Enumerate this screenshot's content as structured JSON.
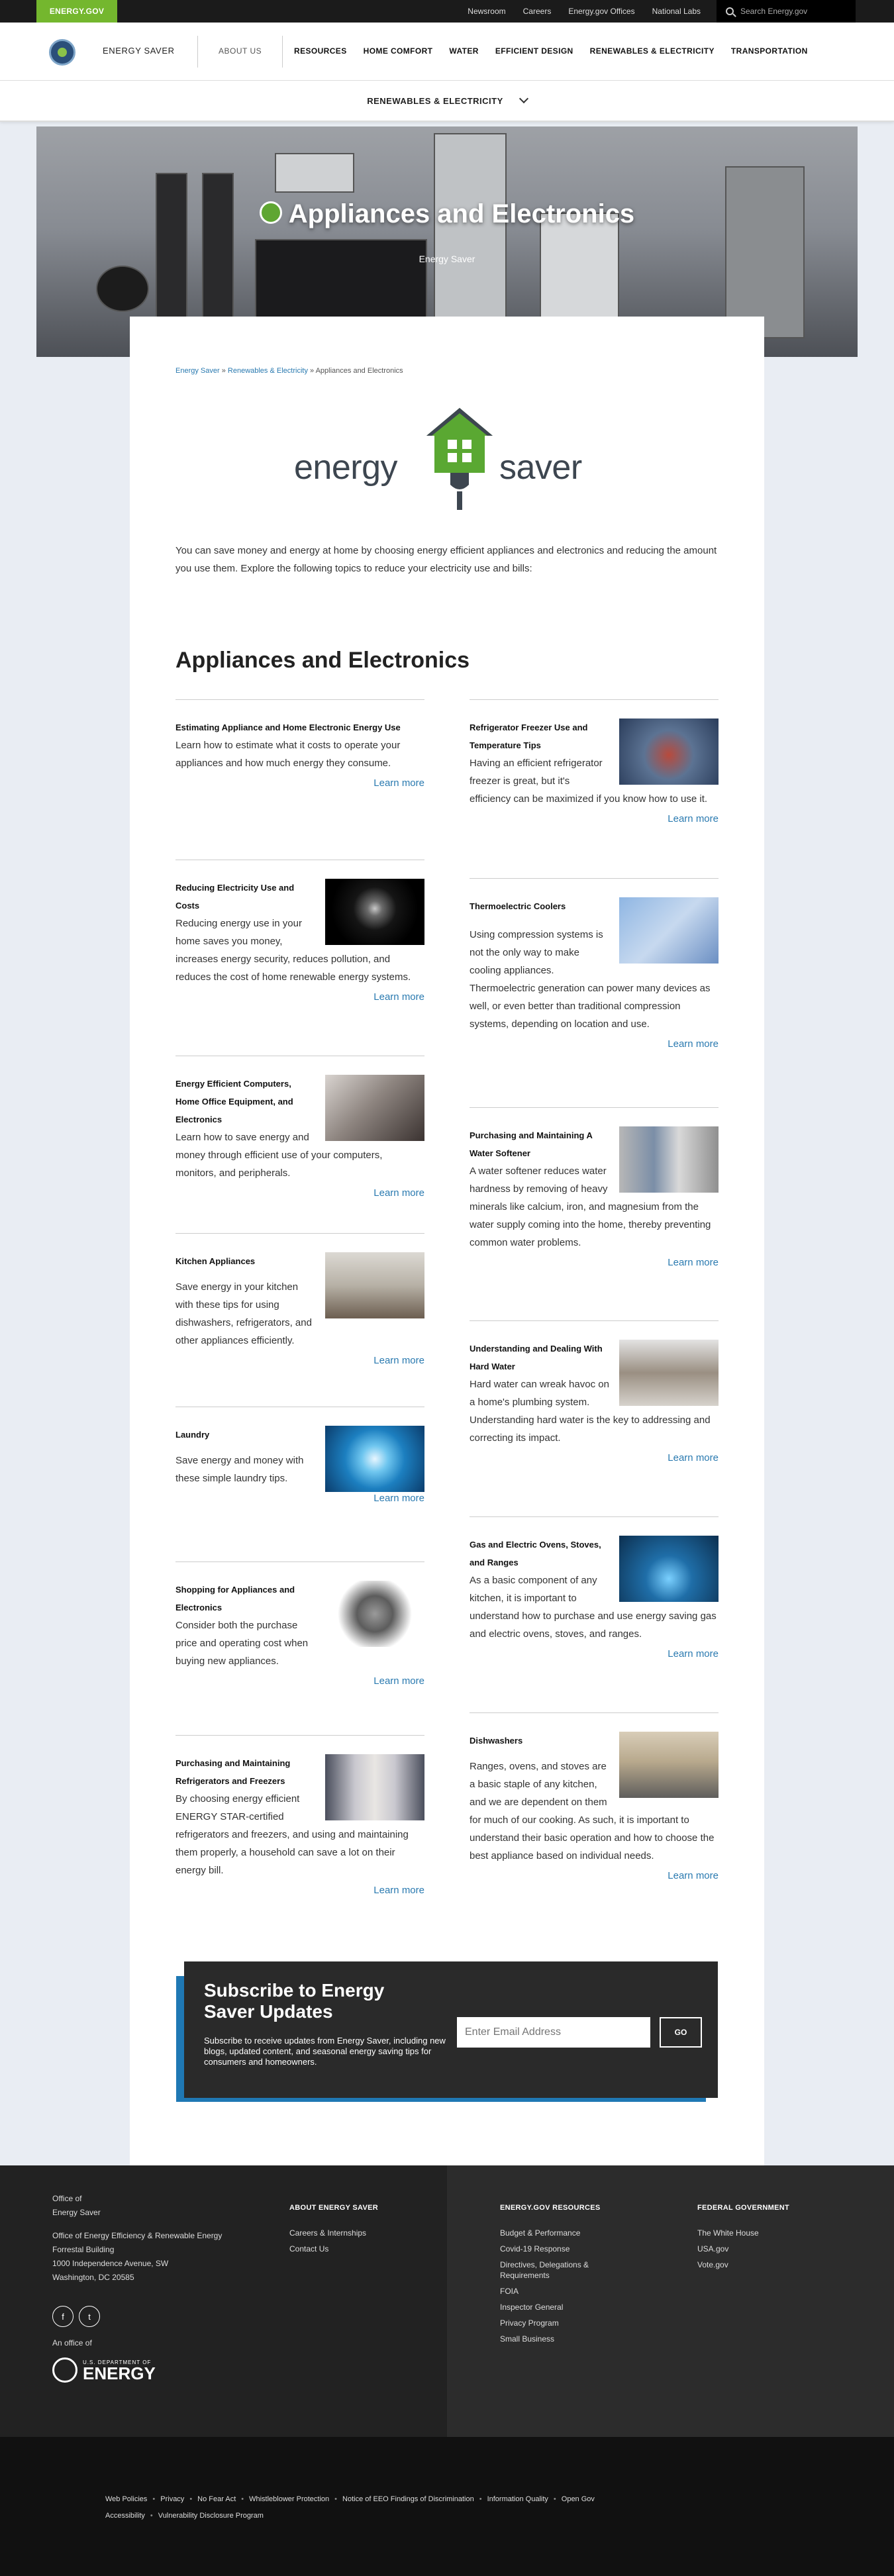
{
  "topbar": {
    "brand": "ENERGY.GOV",
    "links": [
      "Newsroom",
      "Careers",
      "Energy.gov Offices",
      "National Labs"
    ],
    "search_placeholder": "Search Energy.gov"
  },
  "nav": {
    "site_name": "ENERGY SAVER",
    "about": "ABOUT US",
    "items": [
      "RESOURCES",
      "HOME COMFORT",
      "WATER",
      "EFFICIENT DESIGN",
      "RENEWABLES & ELECTRICITY",
      "TRANSPORTATION"
    ]
  },
  "subnav": {
    "label": "RENEWABLES & ELECTRICITY"
  },
  "hero": {
    "title": "Appliances and Electronics",
    "subtitle": "Energy Saver"
  },
  "breadcrumb": {
    "home": "Energy Saver",
    "sep": " » ",
    "section": "Renewables & Electricity",
    "current": "Appliances and Electronics"
  },
  "logo": {
    "left": "energy",
    "right": "saver"
  },
  "intro": "You can save money and energy at home by choosing energy efficient appliances and electronics and reducing the amount you use them. Explore the following topics to reduce your electricity use and bills:",
  "section_title": "Appliances and Electronics",
  "learn_more": "Learn more",
  "left_cards": [
    {
      "title": "Estimating Appliance and Home Electronic Energy Use",
      "text": "Learn how to estimate what it costs to operate your appliances and how much energy they consume."
    },
    {
      "title": "Reducing Electricity Use and Costs",
      "text": "Reducing energy use in your home saves you money, increases energy security, reduces pollution, and reduces the cost of home renewable energy systems."
    },
    {
      "title": "Energy Efficient Computers, Home Office Equipment, and Electronics",
      "text": "Learn how to save energy and money through efficient use of your computers, monitors, and peripherals."
    },
    {
      "title": "Kitchen Appliances",
      "text": "Save energy in your kitchen with these tips for using dishwashers, refrigerators, and other appliances efficiently."
    },
    {
      "title": "Laundry",
      "text": "Save energy and money with these simple laundry tips."
    },
    {
      "title": "Shopping for Appliances and Electronics",
      "text": "Consider both the purchase price and operating cost when buying new appliances."
    },
    {
      "title": "Purchasing and Maintaining Refrigerators and Freezers",
      "text": "By choosing energy efficient ENERGY STAR-certified refrigerators and freezers, and using and maintaining them properly, a household can save a lot on their energy bill."
    }
  ],
  "right_cards": [
    {
      "title": "Refrigerator Freezer Use and Temperature Tips",
      "text": "Having an efficient refrigerator freezer is great, but it's efficiency can be maximized if you know how to use it."
    },
    {
      "title": "Thermoelectric Coolers",
      "text": "Using compression systems is not the only way to make cooling appliances. Thermoelectric generation can power many devices as well, or even better than traditional compression systems, depending on location and use."
    },
    {
      "title": "Purchasing and Maintaining A Water Softener",
      "text": "A water softener reduces water hardness by removing of heavy minerals like calcium, iron, and magnesium from the water supply coming into the home, thereby preventing common water problems."
    },
    {
      "title": "Understanding and Dealing With Hard Water",
      "text": "Hard water can wreak havoc on a home's plumbing system. Understanding hard water is the key to addressing and correcting its impact."
    },
    {
      "title": "Gas and Electric Ovens, Stoves, and Ranges",
      "text": "As a basic component of any kitchen, it is important to understand how to purchase and use energy saving gas and electric ovens, stoves, and ranges."
    },
    {
      "title": "Dishwashers",
      "text": "Ranges, ovens, and stoves are a basic staple of any kitchen, and we are dependent on them for much of our cooking. As such, it is important to understand their basic operation and how to choose the best appliance based on individual needs."
    }
  ],
  "subscribe": {
    "title": "Subscribe to Energy Saver Updates",
    "text": "Subscribe to receive updates from Energy Saver, including new blogs, updated content, and seasonal energy saving tips for consumers and homeowners.",
    "placeholder": "Enter Email Address",
    "button": "GO"
  },
  "footer": {
    "office_of": "Office of",
    "office_name": "Energy Saver",
    "office_parent": "Office of Energy Efficiency & Renewable Energy",
    "building": "Forrestal Building",
    "address1": "1000 Independence Avenue, SW",
    "address2": "Washington, DC 20585",
    "an_office_of": "An office of",
    "doe_small": "U.S. DEPARTMENT OF",
    "doe_big": "ENERGY",
    "about_heading": "ABOUT ENERGY SAVER",
    "about_links": [
      "Careers & Internships",
      "Contact Us"
    ],
    "resources_heading": "ENERGY.GOV RESOURCES",
    "resources_links": [
      "Budget & Performance",
      "Covid-19 Response",
      "Directives, Delegations & Requirements",
      "FOIA",
      "Inspector General",
      "Privacy Program",
      "Small Business"
    ],
    "federal_heading": "FEDERAL GOVERNMENT",
    "federal_links": [
      "The White House",
      "USA.gov",
      "Vote.gov"
    ]
  },
  "legal_links": [
    "Web Policies",
    "Privacy",
    "No Fear Act",
    "Whistleblower Protection",
    "Notice of EEO Findings of Discrimination",
    "Information Quality",
    "Open Gov",
    "Accessibility",
    "Vulnerability Disclosure Program"
  ]
}
